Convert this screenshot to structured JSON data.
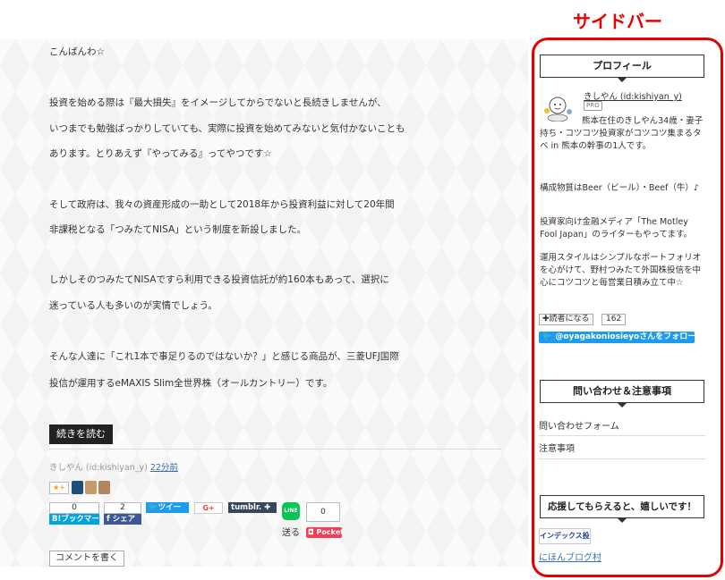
{
  "annotation": {
    "label": "サイドバー",
    "color": "#e60000"
  },
  "article": {
    "paragraphs": [
      "こんばんわ☆",
      "投資を始める際は『最大損失』をイメージしてからでないと長続きしませんが、",
      "いつまでも勉強ばっかりしていても、実際に投資を始めてみないと気付かないことも",
      "あります。とりあえず『やってみる』ってやつです☆",
      "そして政府は、我々の資産形成の一助として2018年から投資利益に対して20年間",
      "非課税となる「つみたてNISA」という制度を新設しました。",
      "しかしそのつみたてNISAですら利用できる投資信託が約160本もあって、選択に",
      "迷っている人も多いのが実情でしょう。",
      "そんな人達に「これ1本で事足りるのではないか？」と感じる商品が、三菱UFJ国際",
      "投信が運用するeMAXIS Slim全世界株（オールカントリー）です。"
    ],
    "read_more": "続きを読む",
    "author": "きしやん (id:kishiyan_y)",
    "posted": "22分前",
    "star_label": "★+",
    "share": {
      "hatena_count": "0",
      "hatena_label": "B!ブックマーク",
      "facebook_count": "2",
      "facebook_label": "f シェア",
      "twitter_label": "ツイー",
      "google_label": "G+",
      "tumblr_label": "tumblr. ✚",
      "line_icon": "LINE",
      "line_label": "送る",
      "pocket_count": "0",
      "pocket_label": "Pocket"
    },
    "comment_button": "コメントを書く"
  },
  "sidebar": {
    "profile": {
      "title": "プロフィール",
      "name": "きしやん (id:kishiyan_y)",
      "badge": "PRO",
      "bio1": "熊本在住のきしやん34歳・妻子持ち・コツコツ投資家がコツコツ集まるタベ in 熊本の幹事の1人です。",
      "bio2": "構成物質はBeer（ビール）・Beef（牛）♪",
      "bio3": "投資家向け金融メディア「The Motley Fool Japan」のライターもやってます。",
      "bio4": "運用スタイルはシンプルなポートフォリオを心がけて、野村つみたて外国株投信を中心にコツコツと毎営業日積み立て中☆",
      "reader_button": "✚読者になる",
      "reader_count": "162",
      "twitter_follow": "@oyagakoniosieyoさんをフォロー"
    },
    "contact": {
      "title": "問い合わせ＆注意事項",
      "links": [
        "問い合わせフォーム",
        "注意事項"
      ]
    },
    "support": {
      "title": "応援してもらえると、嬉しいです！",
      "banner": "インデックス投資",
      "blog_link": "にほんブログ村"
    }
  }
}
